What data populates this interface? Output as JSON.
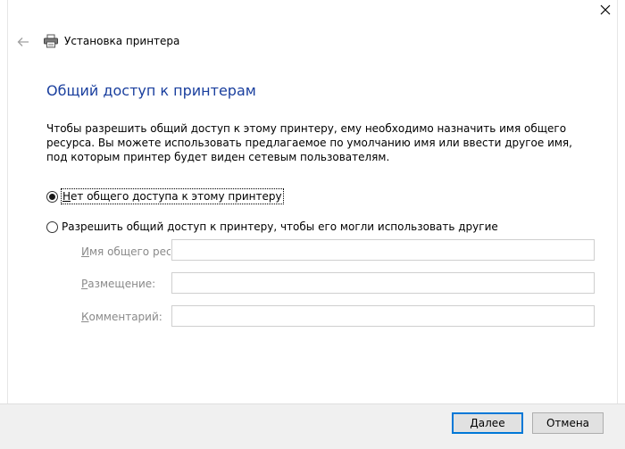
{
  "window": {
    "title": "Установка принтера"
  },
  "page": {
    "heading": "Общий доступ к принтерам",
    "description": "Чтобы разрешить общий доступ к этому принтеру, ему необходимо назначить имя общего ресурса. Вы можете использовать предлагаемое по умолчанию имя или ввести другое имя, под которым принтер будет виден сетевым пользователям."
  },
  "options": {
    "no_share": {
      "first_letter": "Н",
      "rest": "ет общего доступа к этому принтеру",
      "selected": true
    },
    "share": {
      "label": "Разрешить общий доступ к принтеру, чтобы его могли использовать другие",
      "selected": false
    }
  },
  "fields": {
    "share_name": {
      "first_letter": "И",
      "rest": "мя общего ресурса:",
      "value": ""
    },
    "location": {
      "first_letter": "Р",
      "rest": "азмещение:",
      "value": ""
    },
    "comment": {
      "first_letter": "К",
      "rest": "омментарий:",
      "value": ""
    }
  },
  "buttons": {
    "next": {
      "first_letter": "Д",
      "rest": "алее"
    },
    "cancel": {
      "label": "Отмена"
    }
  },
  "colors": {
    "heading": "#1a3f9e",
    "accent": "#0078d7",
    "disabled_text": "#8a8a8a"
  },
  "icons": {
    "close": "close-icon",
    "back": "back-arrow-icon",
    "printer": "printer-icon"
  }
}
